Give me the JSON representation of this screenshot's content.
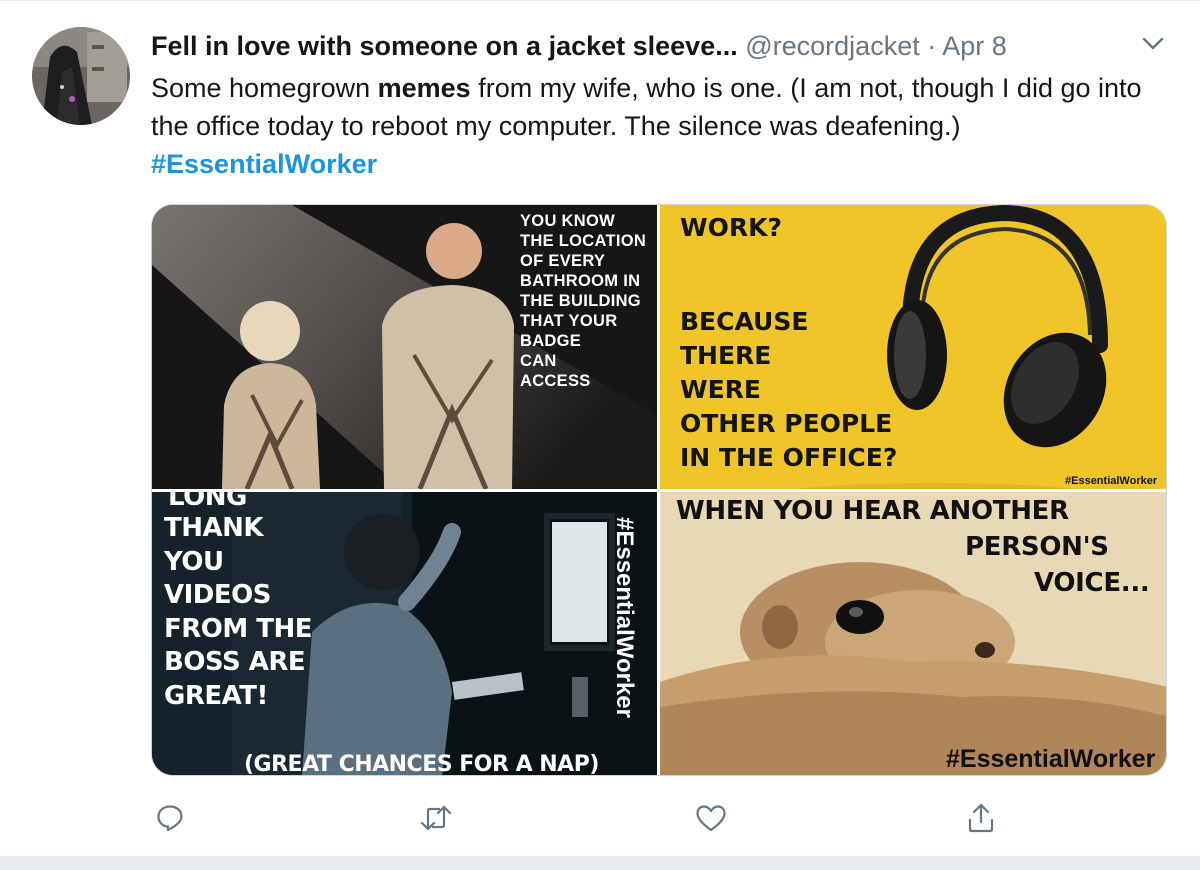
{
  "tweet": {
    "display_name": "Fell in love with someone on a jacket sleeve...",
    "handle": "@recordjacket",
    "separator": "·",
    "date": "Apr 8",
    "text_before_bold": "Some homegrown ",
    "text_bold": "memes",
    "text_after_bold": " from my wife, who is one. (I am not, though I did go into the office today to reboot my computer. The silence was deafening.)",
    "hashtag": "#EssentialWorker"
  },
  "media": {
    "meme1": {
      "caption": "YOU KNOW\nTHE LOCATION\nOF EVERY\nBATHROOM IN\nTHE BUILDING\nTHAT YOUR\nBADGE\nCAN\nACCESS"
    },
    "meme2": {
      "caption_top": "WORK?",
      "caption_main": "BECAUSE\nTHERE\nWERE\nOTHER PEOPLE\nIN THE OFFICE?",
      "tag": "#EssentialWorker"
    },
    "meme3": {
      "caption_top": "LONG",
      "caption_main": "THANK\nYOU\nVIDEOS\nFROM THE\nBOSS ARE\nGREAT!",
      "caption_bottom": "(GREAT CHANCES FOR A NAP)",
      "tag": "#EssentialWorker"
    },
    "meme4": {
      "caption_line1": "WHEN YOU HEAR ANOTHER",
      "caption_line2": "PERSON'S",
      "caption_line3": "VOICE...",
      "tag": "#EssentialWorker"
    }
  },
  "colors": {
    "link": "#1b95e0",
    "secondary_text": "#657786",
    "meme_yellow": "#f0c52a"
  },
  "icons": [
    "chevron-down-icon",
    "reply-icon",
    "retweet-icon",
    "like-icon",
    "share-icon"
  ]
}
